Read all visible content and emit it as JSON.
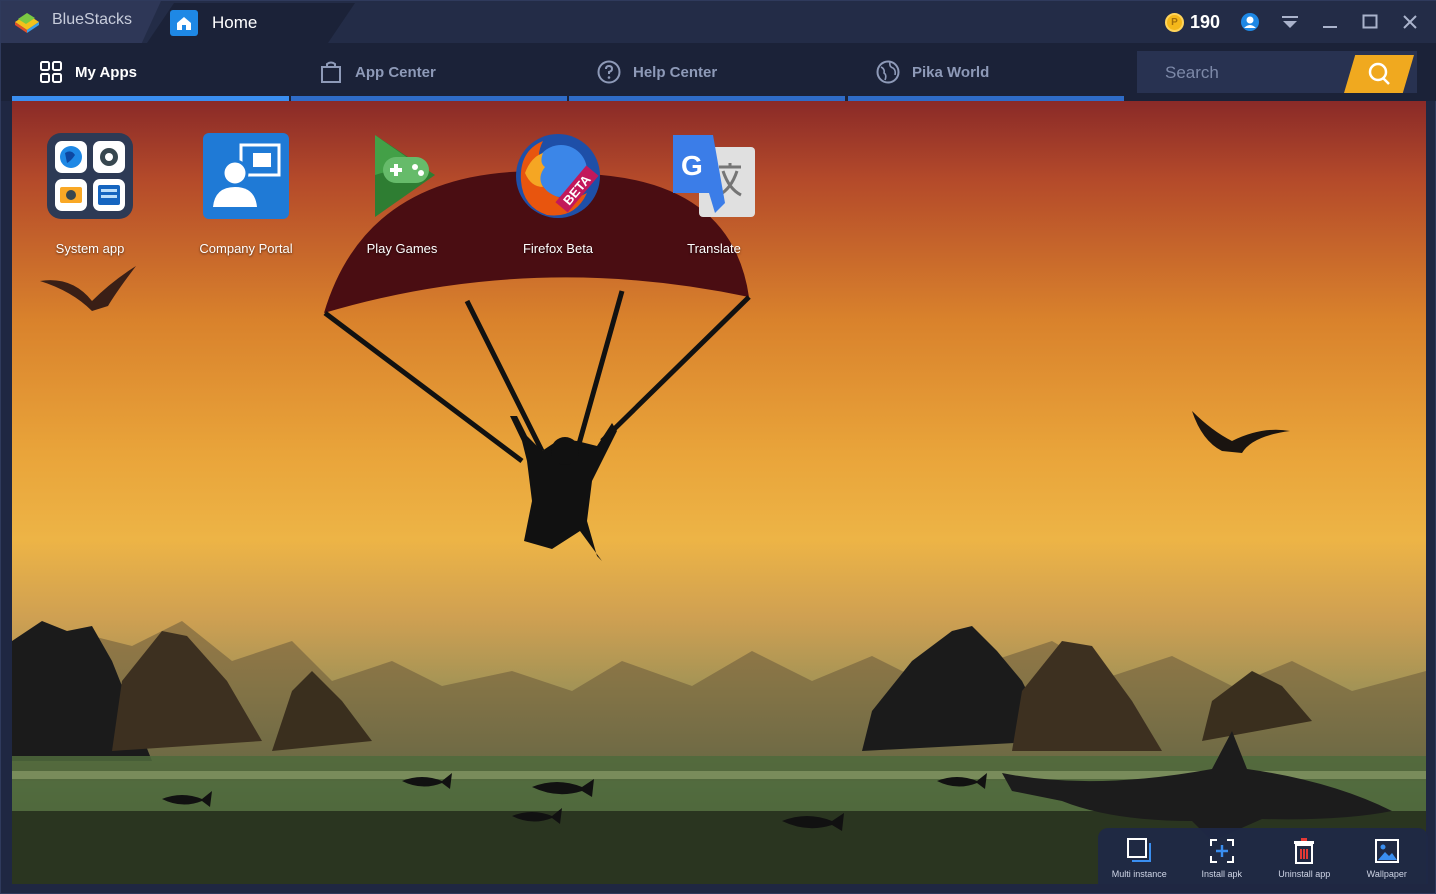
{
  "titlebar": {
    "brand": "BlueStacks",
    "tab_home": "Home",
    "coins": "190",
    "coin_symbol": "P"
  },
  "nav": {
    "items": [
      {
        "label": "My Apps",
        "icon": "grid-icon",
        "active": true
      },
      {
        "label": "App Center",
        "icon": "bag-icon",
        "active": false
      },
      {
        "label": "Help Center",
        "icon": "question-icon",
        "active": false
      },
      {
        "label": "Pika World",
        "icon": "globe-icon",
        "active": false
      }
    ],
    "search_placeholder": "Search"
  },
  "apps": [
    {
      "name": "System app",
      "icon": "system-app-icon"
    },
    {
      "name": "Company Portal",
      "icon": "company-portal-icon"
    },
    {
      "name": "Play Games",
      "icon": "play-games-icon"
    },
    {
      "name": "Firefox Beta",
      "icon": "firefox-beta-icon",
      "badge": "BETA"
    },
    {
      "name": "Translate",
      "icon": "translate-icon",
      "glyph": "G"
    }
  ],
  "toolbar": {
    "items": [
      {
        "label": "Multi instance",
        "icon": "multi-instance-icon"
      },
      {
        "label": "Install apk",
        "icon": "install-apk-icon"
      },
      {
        "label": "Uninstall app",
        "icon": "uninstall-app-icon"
      },
      {
        "label": "Wallpaper",
        "icon": "wallpaper-icon"
      }
    ]
  },
  "colors": {
    "accent": "#3a8ef0",
    "search_button": "#f0a91f",
    "titlebar": "#232c47",
    "navbar": "#1b2238"
  }
}
